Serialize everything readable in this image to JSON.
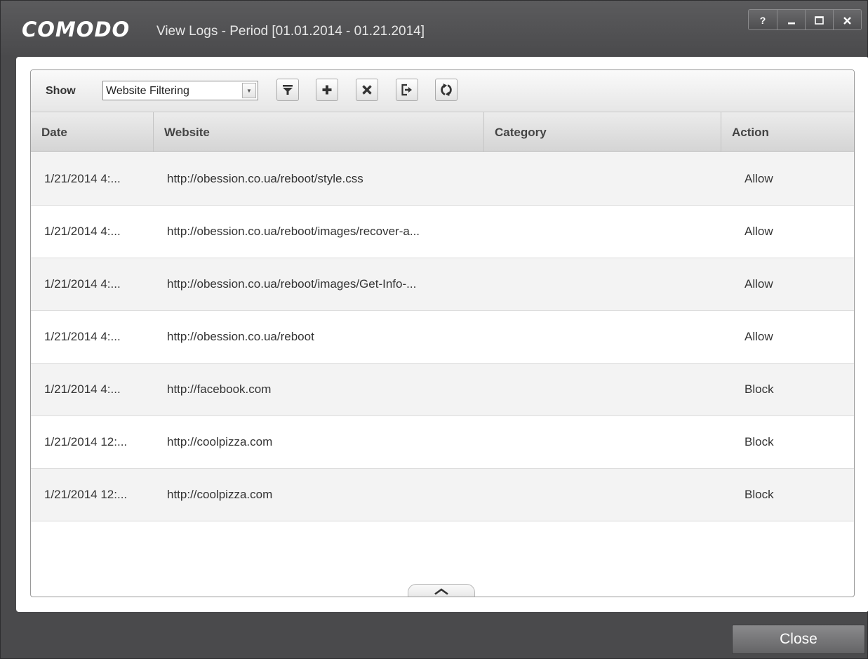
{
  "window": {
    "logo": "COMODO",
    "title": "View Logs - Period [01.01.2014 - 01.21.2014]",
    "controls": {
      "help": "?",
      "minimize": "–",
      "maximize": "□",
      "close": "✕"
    }
  },
  "toolbar": {
    "show_label": "Show",
    "log_type_selected": "Website Filtering",
    "buttons": [
      "filter-icon",
      "add-icon",
      "delete-icon",
      "export-icon",
      "refresh-icon"
    ]
  },
  "table": {
    "columns": {
      "date": "Date",
      "website": "Website",
      "category": "Category",
      "action": "Action"
    },
    "rows": [
      {
        "date": "1/21/2014 4:...",
        "website": "http://obession.co.ua/reboot/style.css",
        "category": "",
        "action": "Allow"
      },
      {
        "date": "1/21/2014 4:...",
        "website": "http://obession.co.ua/reboot/images/recover-a...",
        "category": "",
        "action": "Allow"
      },
      {
        "date": "1/21/2014 4:...",
        "website": "http://obession.co.ua/reboot/images/Get-Info-...",
        "category": "",
        "action": "Allow"
      },
      {
        "date": "1/21/2014 4:...",
        "website": "http://obession.co.ua/reboot",
        "category": "",
        "action": "Allow"
      },
      {
        "date": "1/21/2014 4:...",
        "website": "http://facebook.com",
        "category": "",
        "action": "Block"
      },
      {
        "date": "1/21/2014 12:...",
        "website": "http://coolpizza.com",
        "category": "",
        "action": "Block"
      },
      {
        "date": "1/21/2014 12:...",
        "website": "http://coolpizza.com",
        "category": "",
        "action": "Block"
      }
    ]
  },
  "footer": {
    "close_label": "Close"
  }
}
